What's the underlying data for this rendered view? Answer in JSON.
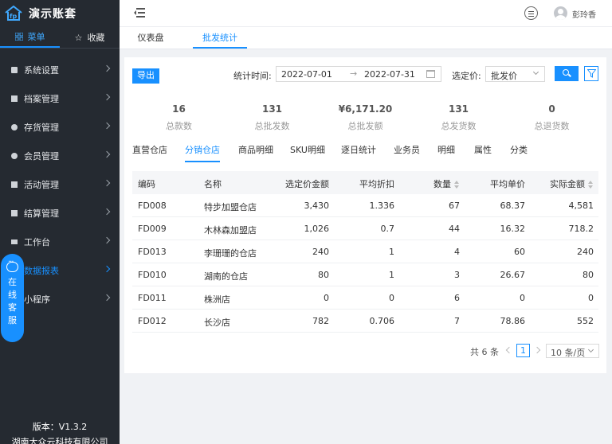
{
  "app": {
    "title": "演示账套"
  },
  "sidebar": {
    "tabs": [
      {
        "label": "菜单",
        "icon": "grid-icon",
        "active": true
      },
      {
        "label": "收藏",
        "icon": "star-icon",
        "active": false
      }
    ],
    "items": [
      {
        "label": "系统设置",
        "icon": "settings-icon"
      },
      {
        "label": "档案管理",
        "icon": "archive-icon"
      },
      {
        "label": "存货管理",
        "icon": "inventory-icon"
      },
      {
        "label": "会员管理",
        "icon": "member-icon"
      },
      {
        "label": "活动管理",
        "icon": "gift-icon"
      },
      {
        "label": "结算管理",
        "icon": "settlement-icon"
      },
      {
        "label": "工作台",
        "icon": "workbench-icon"
      },
      {
        "label": "数据报表",
        "icon": "report-icon",
        "active": true
      },
      {
        "label": "小程序",
        "icon": "miniapp-icon"
      }
    ],
    "footer": {
      "version": "版本：V1.3.2",
      "company": "湖南大众云科技有限公司"
    }
  },
  "float_service": {
    "chars": [
      "在",
      "线",
      "客",
      "服"
    ]
  },
  "header": {
    "user_name": "彭玲香"
  },
  "page_tabs": [
    {
      "label": "仪表盘",
      "active": false
    },
    {
      "label": "批发统计",
      "active": true
    }
  ],
  "toolbar": {
    "export_label": "导出",
    "date_label": "统计时间:",
    "date_start": "2022-07-01",
    "date_sep": "→",
    "date_end": "2022-07-31",
    "price_label": "选定价:",
    "price_value": "批发价"
  },
  "stats": [
    {
      "value": "16",
      "label": "总款数"
    },
    {
      "value": "131",
      "label": "总批发数"
    },
    {
      "value": "¥6,171.20",
      "label": "总批发额"
    },
    {
      "value": "131",
      "label": "总发货数"
    },
    {
      "value": "0",
      "label": "总退货数"
    }
  ],
  "sub_tabs": [
    {
      "label": "直营仓店",
      "active": false
    },
    {
      "label": "分销仓店",
      "active": true
    },
    {
      "label": "商品明细",
      "active": false
    },
    {
      "label": "SKU明细",
      "active": false
    },
    {
      "label": "逐日统计",
      "active": false
    },
    {
      "label": "业务员",
      "active": false
    },
    {
      "label": "明细",
      "active": false
    },
    {
      "label": "属性",
      "active": false
    },
    {
      "label": "分类",
      "active": false
    }
  ],
  "table": {
    "headers": [
      "编码",
      "名称",
      "选定价金额",
      "平均折扣",
      "数量",
      "平均单价",
      "实际金额"
    ],
    "rows": [
      [
        "FD008",
        "特步加盟仓店",
        "3,430",
        "1.336",
        "67",
        "68.37",
        "4,581"
      ],
      [
        "FD009",
        "木林森加盟店",
        "1,026",
        "0.7",
        "44",
        "16.32",
        "718.2"
      ],
      [
        "FD013",
        "李珊珊的仓店",
        "240",
        "1",
        "4",
        "60",
        "240"
      ],
      [
        "FD010",
        "湖南的仓店",
        "80",
        "1",
        "3",
        "26.67",
        "80"
      ],
      [
        "FD011",
        "株洲店",
        "0",
        "0",
        "6",
        "0",
        "0"
      ],
      [
        "FD012",
        "长沙店",
        "782",
        "0.706",
        "7",
        "78.86",
        "552"
      ]
    ]
  },
  "pagination": {
    "total": "共 6 条",
    "page": "1",
    "page_size": "10 条/页"
  },
  "colors": {
    "primary": "#1890ff",
    "sidebar_bg": "#252a31"
  }
}
